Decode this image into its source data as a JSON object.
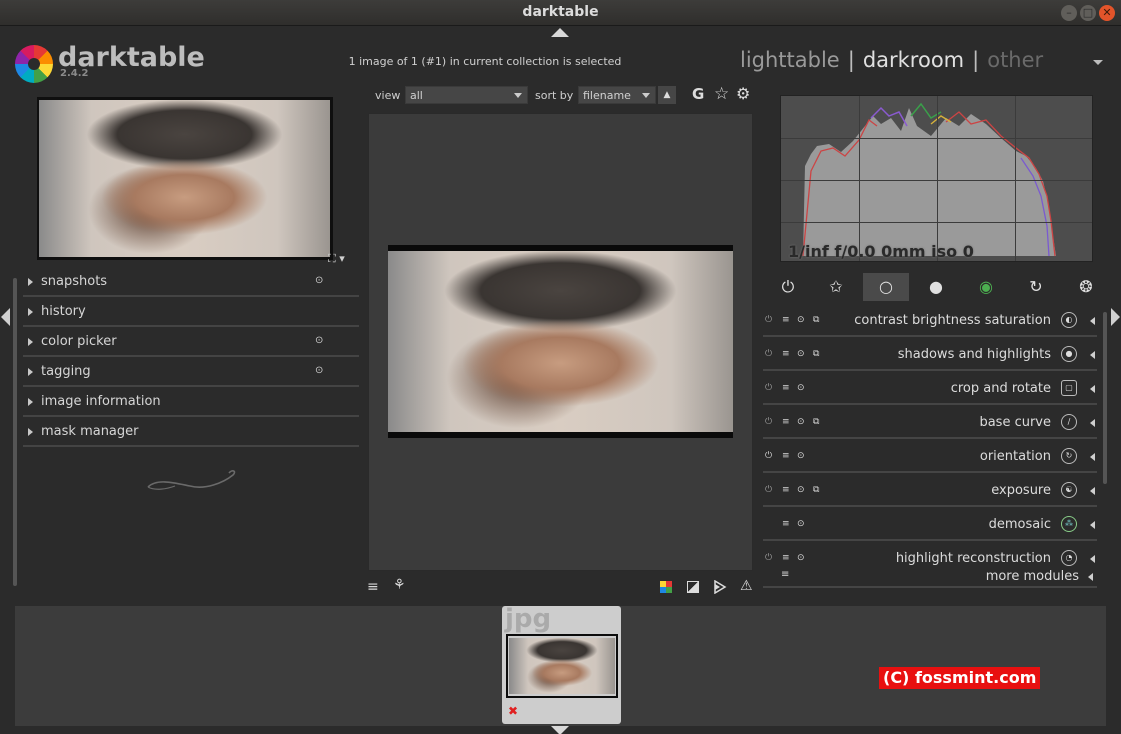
{
  "window": {
    "title": "darktable",
    "min_icon": "minimize-icon",
    "max_icon": "maximize-icon",
    "close_icon": "close-icon"
  },
  "header": {
    "app_name": "darktable",
    "version": "2.4.2",
    "collection_info": "1 image of 1 (#1) in current collection is selected",
    "views": [
      {
        "label": "lighttable",
        "active": false
      },
      {
        "label": "darkroom",
        "active": true
      },
      {
        "label": "other",
        "active": false
      }
    ],
    "view_separator": "|"
  },
  "left_panel": {
    "modules": [
      {
        "label": "snapshots",
        "pinned": true
      },
      {
        "label": "history",
        "pinned": false
      },
      {
        "label": "color picker",
        "pinned": true
      },
      {
        "label": "tagging",
        "pinned": true
      },
      {
        "label": "image information",
        "pinned": false
      },
      {
        "label": "mask manager",
        "pinned": false
      }
    ],
    "pin_glyph": "⊙",
    "thumb_controls": "⛶ ▾"
  },
  "center_toolbar": {
    "view_label": "view",
    "view_value": "all",
    "sort_label": "sort by",
    "sort_value": "filename",
    "sort_dir_glyph": "▲",
    "grouping_label": "G",
    "star_glyph": "☆",
    "gear_glyph": "⚙"
  },
  "bottom_toolbar": {
    "presets_glyph": "≡",
    "styles_glyph": "⚘",
    "color_assess_icon": "color-assessment-icon",
    "overexposed_icon": "overexposed-icon",
    "softproof_icon": "softproof-icon",
    "gamut_glyph": "⚠"
  },
  "histogram": {
    "exif": "1/inf f/0.0 0mm iso 0"
  },
  "module_groups": [
    {
      "name": "power-icon",
      "glyph": "⏻",
      "active": false
    },
    {
      "name": "favorites-icon",
      "glyph": "✩",
      "active": false
    },
    {
      "name": "basic-group-icon",
      "glyph": "○",
      "active": true
    },
    {
      "name": "tone-group-icon",
      "glyph": "●",
      "active": false
    },
    {
      "name": "color-group-icon",
      "glyph": "◉",
      "active": false
    },
    {
      "name": "correct-group-icon",
      "glyph": "↻",
      "active": false
    },
    {
      "name": "effect-group-icon",
      "glyph": "❂",
      "active": false
    }
  ],
  "right_modules": [
    {
      "label": "contrast brightness saturation",
      "icon_glyph": "◐",
      "power": false,
      "presets": true
    },
    {
      "label": "shadows and highlights",
      "icon_glyph": "●",
      "power": false,
      "presets": true
    },
    {
      "label": "crop and rotate",
      "icon_glyph": "▢",
      "power": false,
      "presets": false
    },
    {
      "label": "base curve",
      "icon_glyph": "∕",
      "power": false,
      "presets": true
    },
    {
      "label": "orientation",
      "icon_glyph": "↻",
      "power": true,
      "presets": false
    },
    {
      "label": "exposure",
      "icon_glyph": "☯",
      "power": false,
      "presets": true
    },
    {
      "label": "demosaic",
      "icon_glyph": "⁂",
      "power": null,
      "presets": false
    },
    {
      "label": "highlight reconstruction",
      "icon_glyph": "◔",
      "power": false,
      "presets": false
    }
  ],
  "more_modules": {
    "label": "more modules"
  },
  "filmstrip": {
    "extension": "jpg",
    "reject_glyph": "✖"
  },
  "watermark": {
    "text": "(C) fossmint.com"
  },
  "colors": {
    "accent_close": "#e3542a",
    "watermark_bg": "#e81010",
    "panel_bg": "#2b2b2b"
  }
}
